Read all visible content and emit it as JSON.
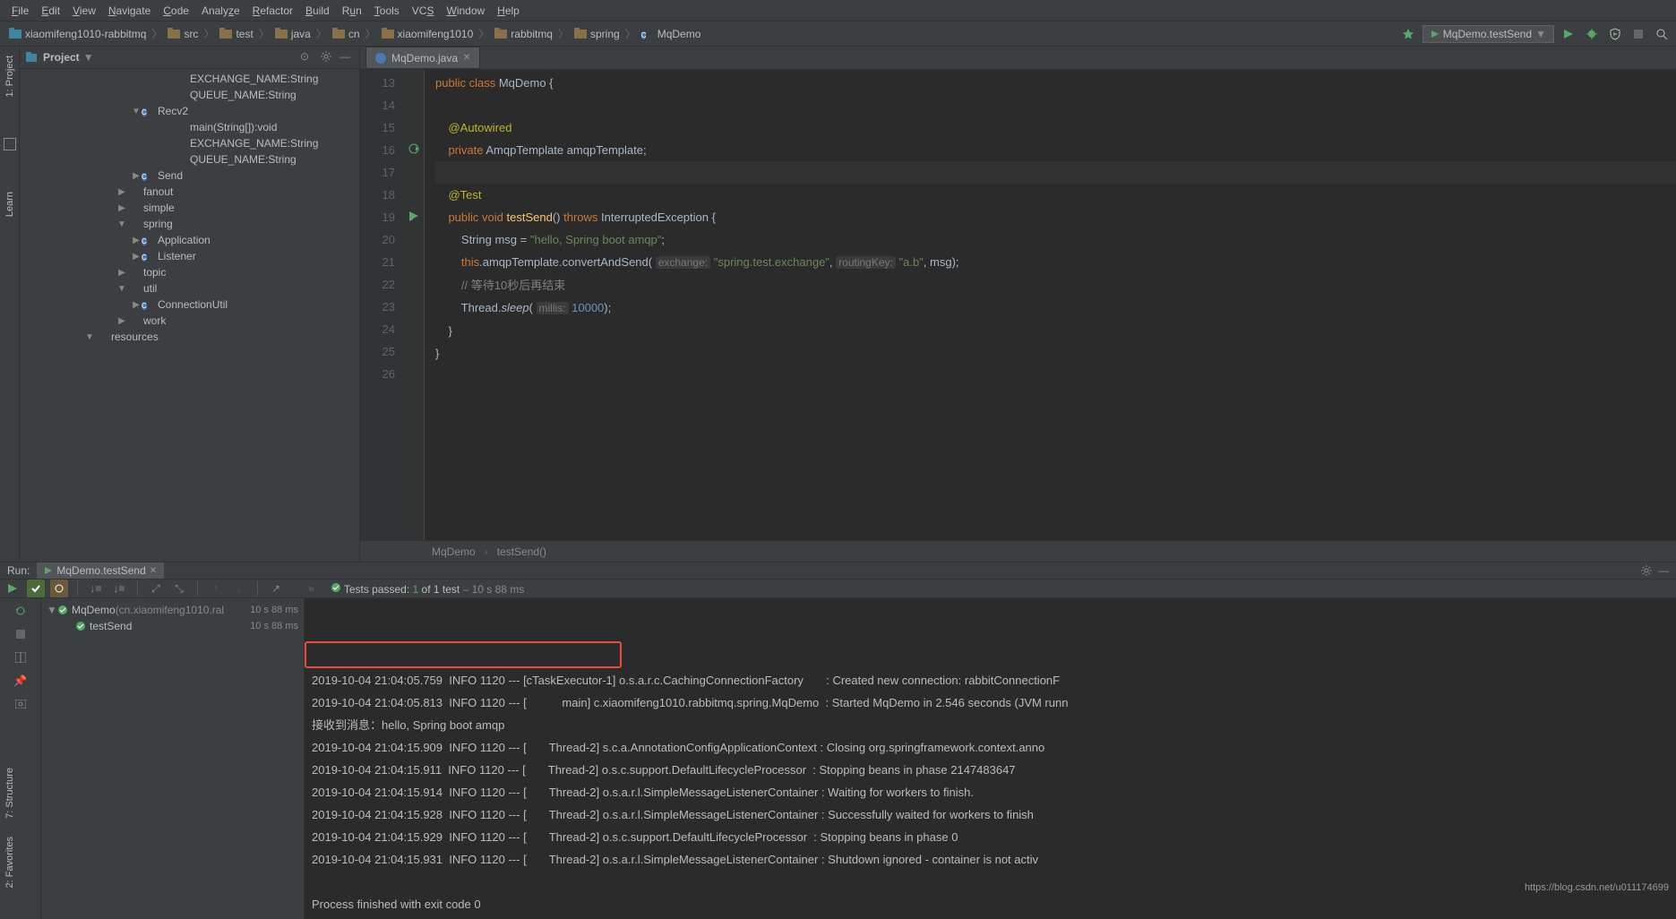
{
  "menu": [
    "File",
    "Edit",
    "View",
    "Navigate",
    "Code",
    "Analyze",
    "Refactor",
    "Build",
    "Run",
    "Tools",
    "VCS",
    "Window",
    "Help"
  ],
  "breadcrumbs": [
    {
      "icon": "project",
      "label": "xiaomifeng1010-rabbitmq"
    },
    {
      "icon": "folder",
      "label": "src"
    },
    {
      "icon": "folder",
      "label": "test"
    },
    {
      "icon": "folder",
      "label": "java"
    },
    {
      "icon": "folder",
      "label": "cn"
    },
    {
      "icon": "folder",
      "label": "xiaomifeng1010"
    },
    {
      "icon": "folder",
      "label": "rabbitmq"
    },
    {
      "icon": "folder",
      "label": "spring"
    },
    {
      "icon": "class",
      "label": "MqDemo"
    }
  ],
  "runconfig": "MqDemo.testSend",
  "project": {
    "title": "Project",
    "tree": [
      {
        "indent": 160,
        "tw": "",
        "icon": "field",
        "label": "EXCHANGE_NAME:String"
      },
      {
        "indent": 160,
        "tw": "",
        "icon": "field",
        "label": "QUEUE_NAME:String"
      },
      {
        "indent": 124,
        "tw": "▼",
        "icon": "class",
        "label": "Recv2"
      },
      {
        "indent": 160,
        "tw": "",
        "icon": "method",
        "label": "main(String[]):void"
      },
      {
        "indent": 160,
        "tw": "",
        "icon": "field",
        "label": "EXCHANGE_NAME:String"
      },
      {
        "indent": 160,
        "tw": "",
        "icon": "field",
        "label": "QUEUE_NAME:String"
      },
      {
        "indent": 124,
        "tw": "▶",
        "icon": "class",
        "label": "Send"
      },
      {
        "indent": 108,
        "tw": "▶",
        "icon": "folder",
        "label": "fanout"
      },
      {
        "indent": 108,
        "tw": "▶",
        "icon": "folder",
        "label": "simple"
      },
      {
        "indent": 108,
        "tw": "▼",
        "icon": "folder",
        "label": "spring"
      },
      {
        "indent": 124,
        "tw": "▶",
        "icon": "class",
        "label": "Application"
      },
      {
        "indent": 124,
        "tw": "▶",
        "icon": "class",
        "label": "Listener"
      },
      {
        "indent": 108,
        "tw": "▶",
        "icon": "folder",
        "label": "topic"
      },
      {
        "indent": 108,
        "tw": "▼",
        "icon": "folder",
        "label": "util"
      },
      {
        "indent": 124,
        "tw": "▶",
        "icon": "class",
        "label": "ConnectionUtil"
      },
      {
        "indent": 108,
        "tw": "▶",
        "icon": "folder",
        "label": "work"
      },
      {
        "indent": 72,
        "tw": "▼",
        "icon": "folder",
        "label": "resources"
      }
    ]
  },
  "tab": {
    "label": "MqDemo.java"
  },
  "code": {
    "lines": [
      {
        "n": 13,
        "html": "<span class='kw'>public class</span> MqDemo {",
        "pre": ""
      },
      {
        "n": 14,
        "html": "",
        "pre": ""
      },
      {
        "n": 15,
        "html": "    <span class='ann'>@Autowired</span>",
        "pre": ""
      },
      {
        "n": 16,
        "html": "    <span class='kw'>private</span> AmqpTemplate amqpTemplate;",
        "pre": "",
        "gicon": "recurse"
      },
      {
        "n": 17,
        "html": "",
        "pre": "",
        "cur": true
      },
      {
        "n": 18,
        "html": "    <span class='ann'>@Test</span>",
        "pre": ""
      },
      {
        "n": 19,
        "html": "    <span class='kw'>public void</span> <span class='method'>testSend</span>() <span class='kw'>throws</span> InterruptedException {",
        "pre": "",
        "gicon": "run"
      },
      {
        "n": 20,
        "html": "        String msg = <span class='str'>\"hello, Spring boot amqp\"</span>;",
        "pre": ""
      },
      {
        "n": 21,
        "html": "        <span class='kw'>this</span>.amqpTemplate.convertAndSend( <span class='hint'>exchange:</span> <span class='str'>\"spring.test.exchange\"</span>, <span class='hint'>routingKey:</span> <span class='str'>\"a.b\"</span>, msg);",
        "pre": ""
      },
      {
        "n": 22,
        "html": "        <span class='com'>// 等待10秒后再结束</span>",
        "pre": ""
      },
      {
        "n": 23,
        "html": "        Thread.<span class='it'>sleep</span>( <span class='hint'>millis:</span> <span class='num'>10000</span>);",
        "pre": ""
      },
      {
        "n": 24,
        "html": "    }",
        "pre": ""
      },
      {
        "n": 25,
        "html": "}",
        "pre": ""
      },
      {
        "n": 26,
        "html": "",
        "pre": ""
      }
    ],
    "crumb1": "MqDemo",
    "crumb2": "testSend()"
  },
  "run": {
    "title": "Run:",
    "tab": "MqDemo.testSend",
    "tests_label": "Tests passed:",
    "tests_count": "1",
    "tests_of": " of 1 test",
    "tests_time": " – 10 s 88 ms",
    "tree": [
      {
        "indent": 0,
        "tw": "▼",
        "icon": "ok",
        "label": "MqDemo",
        "sub": "(cn.xiaomifeng1010.ral",
        "time": "10 s 88 ms"
      },
      {
        "indent": 20,
        "tw": "",
        "icon": "ok",
        "label": "testSend",
        "sub": "",
        "time": "10 s 88 ms"
      }
    ],
    "console": [
      "2019-10-04 21:04:05.759  INFO 1120 --- [cTaskExecutor-1] o.s.a.r.c.CachingConnectionFactory       : Created new connection: rabbitConnectionF",
      "2019-10-04 21:04:05.813  INFO 1120 --- [           main] c.xiaomifeng1010.rabbitmq.spring.MqDemo  : Started MqDemo in 2.546 seconds (JVM runn",
      "接收到消息：hello, Spring boot amqp",
      "2019-10-04 21:04:15.909  INFO 1120 --- [       Thread-2] s.c.a.AnnotationConfigApplicationContext : Closing org.springframework.context.anno",
      "2019-10-04 21:04:15.911  INFO 1120 --- [       Thread-2] o.s.c.support.DefaultLifecycleProcessor  : Stopping beans in phase 2147483647",
      "2019-10-04 21:04:15.914  INFO 1120 --- [       Thread-2] o.s.a.r.l.SimpleMessageListenerContainer : Waiting for workers to finish.",
      "2019-10-04 21:04:15.928  INFO 1120 --- [       Thread-2] o.s.a.r.l.SimpleMessageListenerContainer : Successfully waited for workers to finish",
      "2019-10-04 21:04:15.929  INFO 1120 --- [       Thread-2] o.s.c.support.DefaultLifecycleProcessor  : Stopping beans in phase 0",
      "2019-10-04 21:04:15.931  INFO 1120 --- [       Thread-2] o.s.a.r.l.SimpleMessageListenerContainer : Shutdown ignored - container is not activ",
      "",
      "Process finished with exit code 0"
    ]
  },
  "watermark": "https://blog.csdn.net/u011174699",
  "sidetabs": {
    "favorites": "2: Favorites",
    "structure": "7: Structure",
    "learn": "Learn",
    "project": "1: Project"
  }
}
